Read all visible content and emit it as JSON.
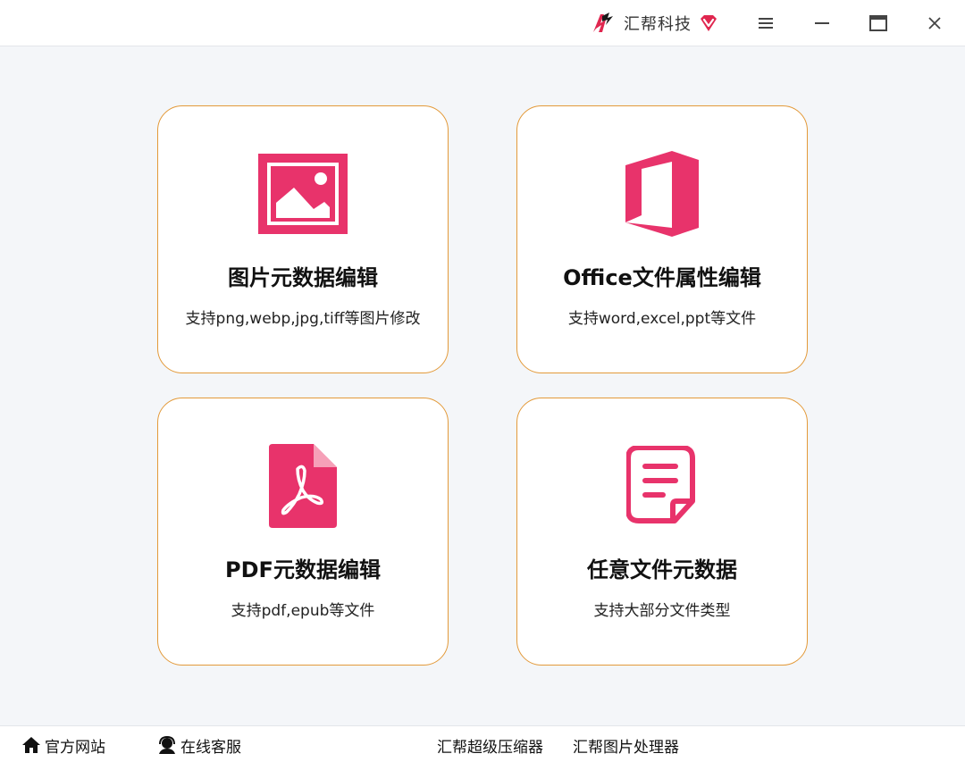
{
  "titlebar": {
    "brand_name": "汇帮科技",
    "brand_color": "#e0264f",
    "icons": [
      "brand-logo-icon",
      "vip-diamond-icon",
      "menu-icon",
      "minimize-icon",
      "maximize-icon",
      "close-icon"
    ]
  },
  "cards": [
    {
      "title": "图片元数据编辑",
      "desc": "支持png,webp,jpg,tiff等图片修改",
      "icon": "image-icon"
    },
    {
      "title": "Office文件属性编辑",
      "desc": "支持word,excel,ppt等文件",
      "icon": "office-icon"
    },
    {
      "title": "PDF元数据编辑",
      "desc": "支持pdf,epub等文件",
      "icon": "pdf-icon"
    },
    {
      "title": "任意文件元数据",
      "desc": "支持大部分文件类型",
      "icon": "document-icon"
    }
  ],
  "footer": {
    "website_label": "官方网站",
    "service_label": "在线客服",
    "compressor_label": "汇帮超级压缩器",
    "image_processor_label": "汇帮图片处理器"
  },
  "colors": {
    "accent": "#e8336b",
    "card_border": "#e39a3a",
    "background": "#f4f6f9"
  }
}
